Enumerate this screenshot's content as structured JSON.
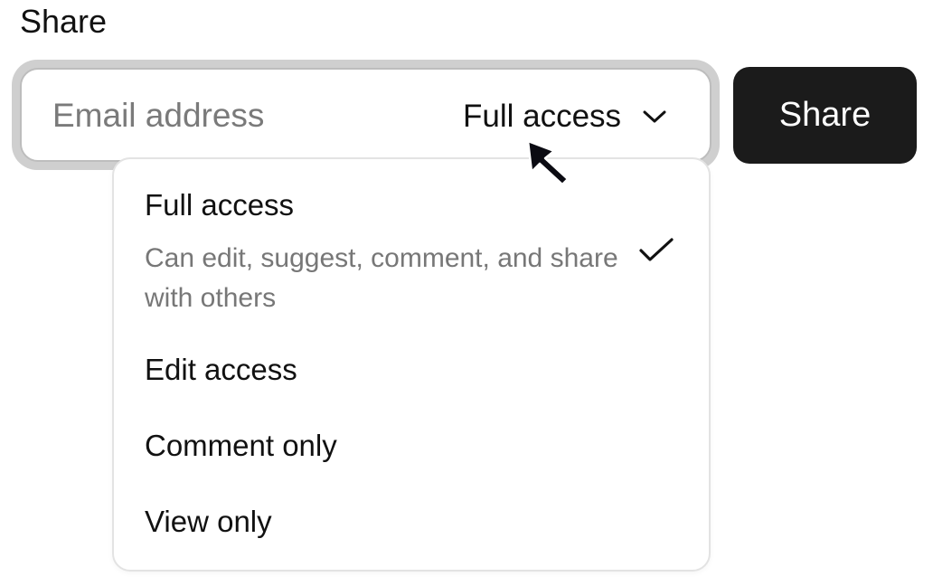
{
  "header": {
    "title": "Share"
  },
  "share_form": {
    "email_placeholder": "Email address",
    "email_value": "",
    "access_selected": "Full access",
    "share_label": "Share"
  },
  "access_menu": {
    "items": [
      {
        "label": "Full access",
        "description": "Can edit, suggest, comment, and share with others",
        "selected": true
      },
      {
        "label": "Edit access",
        "selected": false
      },
      {
        "label": "Comment only",
        "selected": false
      },
      {
        "label": "View only",
        "selected": false
      }
    ]
  },
  "icons": {
    "dropdown": "chevron-down-icon",
    "selected": "checkmark-icon",
    "pointer": "mouse-cursor-icon"
  },
  "colors": {
    "share_button_bg": "#1b1b1b",
    "share_button_text": "#ffffff",
    "focus_ring": "#cfcfcf",
    "description_text": "#777777",
    "placeholder_text": "#7a7a7a"
  }
}
